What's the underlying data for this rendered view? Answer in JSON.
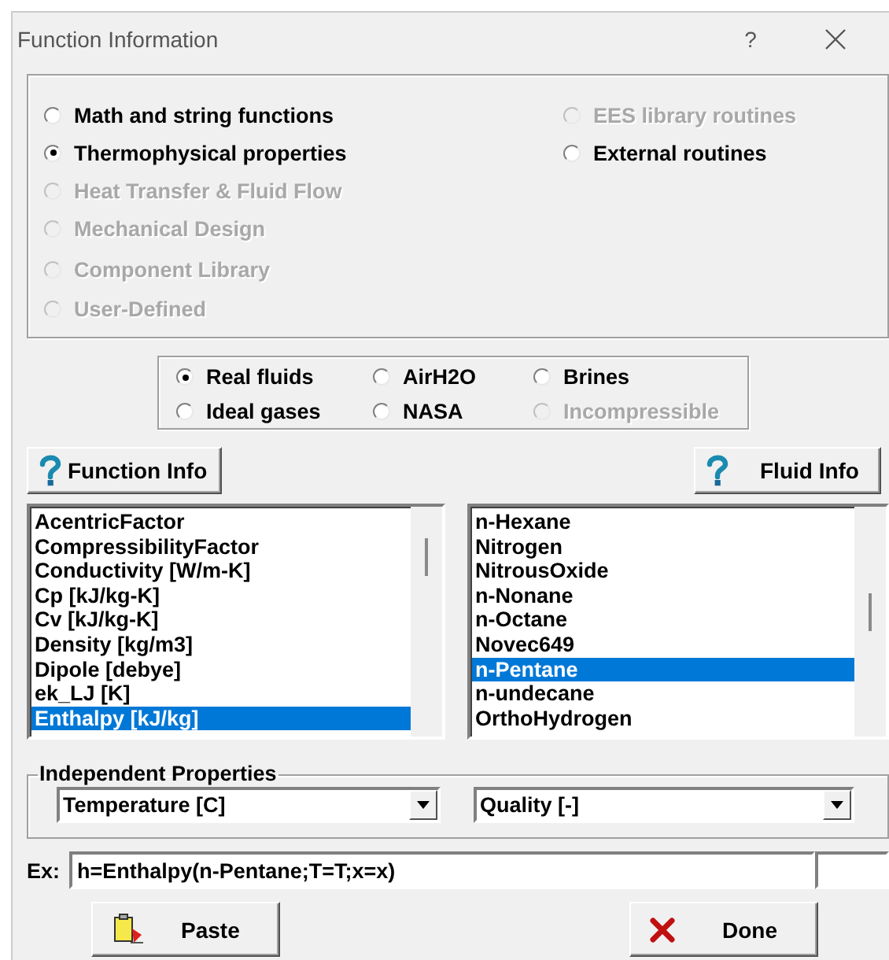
{
  "window": {
    "title": "Function Information",
    "help_button": "?"
  },
  "categories_left": [
    {
      "label": "Math and string functions",
      "selected": false,
      "disabled": false
    },
    {
      "label": "Thermophysical properties",
      "selected": true,
      "disabled": false
    },
    {
      "label": "Heat Transfer & Fluid Flow",
      "selected": false,
      "disabled": true
    },
    {
      "label": "Mechanical Design",
      "selected": false,
      "disabled": true
    },
    {
      "label": "Component Library",
      "selected": false,
      "disabled": true
    },
    {
      "label": "User-Defined",
      "selected": false,
      "disabled": true
    }
  ],
  "categories_right": [
    {
      "label": "EES library routines",
      "selected": false,
      "disabled": true
    },
    {
      "label": "External routines",
      "selected": false,
      "disabled": false
    }
  ],
  "fluid_types": [
    {
      "label": "Real fluids",
      "selected": true,
      "disabled": false
    },
    {
      "label": "AirH2O",
      "selected": false,
      "disabled": false
    },
    {
      "label": "Brines",
      "selected": false,
      "disabled": false
    },
    {
      "label": "Ideal gases",
      "selected": false,
      "disabled": false
    },
    {
      "label": "NASA",
      "selected": false,
      "disabled": false
    },
    {
      "label": "Incompressible",
      "selected": false,
      "disabled": true
    }
  ],
  "function_info_button": "Function Info",
  "fluid_info_button": "Fluid Info",
  "functions": [
    {
      "label": "AcentricFactor",
      "selected": false
    },
    {
      "label": "CompressibilityFactor",
      "selected": false
    },
    {
      "label": "Conductivity [W/m-K]",
      "selected": false
    },
    {
      "label": "Cp [kJ/kg-K]",
      "selected": false
    },
    {
      "label": "Cv [kJ/kg-K]",
      "selected": false
    },
    {
      "label": "Density [kg/m3]",
      "selected": false
    },
    {
      "label": "Dipole [debye]",
      "selected": false
    },
    {
      "label": "ek_LJ [K]",
      "selected": false
    },
    {
      "label": "Enthalpy [kJ/kg]",
      "selected": true
    }
  ],
  "fluids": [
    {
      "label": "n-Hexane",
      "selected": false
    },
    {
      "label": "Nitrogen",
      "selected": false
    },
    {
      "label": "NitrousOxide",
      "selected": false
    },
    {
      "label": "n-Nonane",
      "selected": false
    },
    {
      "label": "n-Octane",
      "selected": false
    },
    {
      "label": "Novec649",
      "selected": false
    },
    {
      "label": "n-Pentane",
      "selected": true
    },
    {
      "label": "n-undecane",
      "selected": false
    },
    {
      "label": "OrthoHydrogen",
      "selected": false
    }
  ],
  "independent_properties": {
    "title": "Independent Properties",
    "property_1": "Temperature [C]",
    "property_2": "Quality [-]"
  },
  "example": {
    "label": "Ex:",
    "value": "h=Enthalpy(n-Pentane;T=T;x=x)"
  },
  "paste_button": "Paste",
  "done_button": "Done"
}
